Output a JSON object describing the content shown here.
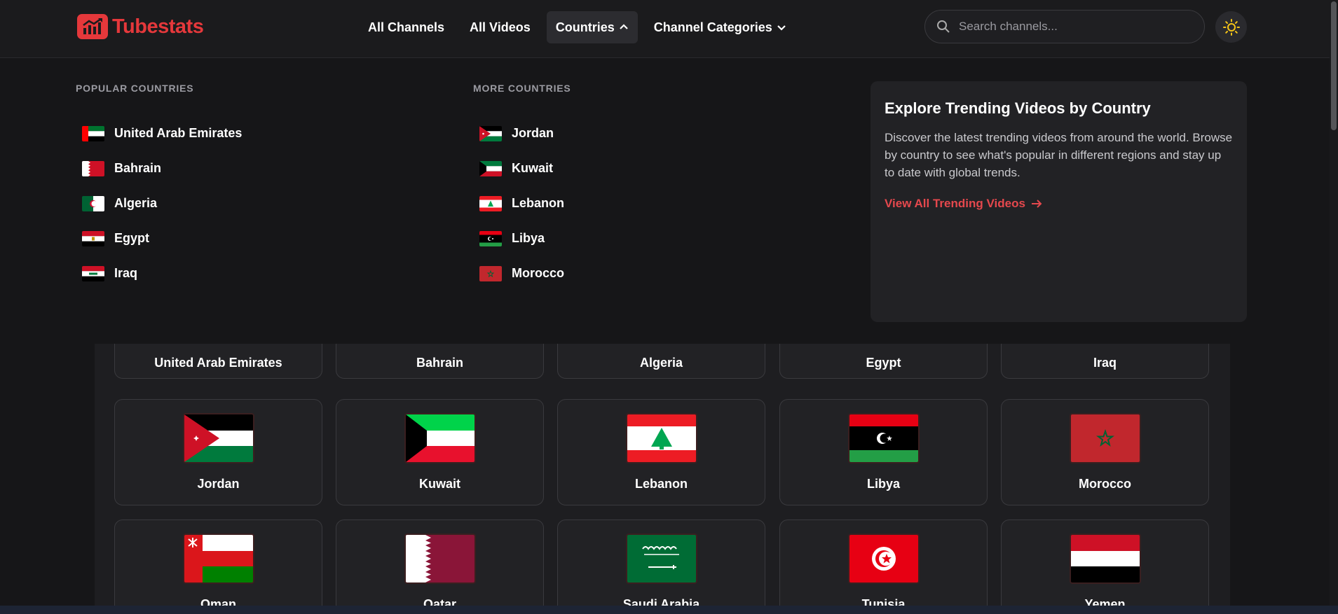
{
  "app": {
    "brand": "Tubestats",
    "brand_color": "#e5383b"
  },
  "nav": {
    "items": [
      {
        "label": "All Channels",
        "has_chevron": false,
        "active": false
      },
      {
        "label": "All Videos",
        "has_chevron": false,
        "active": false
      },
      {
        "label": "Countries",
        "has_chevron": true,
        "chevron": "up",
        "active": true
      },
      {
        "label": "Channel Categories",
        "has_chevron": true,
        "chevron": "down",
        "active": false
      }
    ]
  },
  "search": {
    "placeholder": "Search channels...",
    "value": ""
  },
  "dropdown": {
    "popular_heading": "POPULAR COUNTRIES",
    "more_heading": "MORE COUNTRIES",
    "popular": [
      {
        "label": "United Arab Emirates",
        "flag": "ae"
      },
      {
        "label": "Bahrain",
        "flag": "bh"
      },
      {
        "label": "Algeria",
        "flag": "dz"
      },
      {
        "label": "Egypt",
        "flag": "eg"
      },
      {
        "label": "Iraq",
        "flag": "iq"
      }
    ],
    "more": [
      {
        "label": "Jordan",
        "flag": "jo"
      },
      {
        "label": "Kuwait",
        "flag": "kw"
      },
      {
        "label": "Lebanon",
        "flag": "lb"
      },
      {
        "label": "Libya",
        "flag": "ly"
      },
      {
        "label": "Morocco",
        "flag": "ma"
      }
    ],
    "promo": {
      "title": "Explore Trending Videos by Country",
      "text": "Discover the latest trending videos from around the world. Browse by country to see what's popular in different regions and stay up to date with global trends.",
      "link": "View All Trending Videos"
    }
  },
  "grid": {
    "row1": [
      {
        "label": "United Arab Emirates",
        "flag": "ae"
      },
      {
        "label": "Bahrain",
        "flag": "bh"
      },
      {
        "label": "Algeria",
        "flag": "dz"
      },
      {
        "label": "Egypt",
        "flag": "eg"
      },
      {
        "label": "Iraq",
        "flag": "iq"
      }
    ],
    "row2": [
      {
        "label": "Jordan",
        "flag": "jo"
      },
      {
        "label": "Kuwait",
        "flag": "kw"
      },
      {
        "label": "Lebanon",
        "flag": "lb"
      },
      {
        "label": "Libya",
        "flag": "ly"
      },
      {
        "label": "Morocco",
        "flag": "ma"
      }
    ],
    "row3": [
      {
        "label": "Oman",
        "flag": "om"
      },
      {
        "label": "Qatar",
        "flag": "qa"
      },
      {
        "label": "Saudi Arabia",
        "flag": "sa"
      },
      {
        "label": "Tunisia",
        "flag": "tn"
      },
      {
        "label": "Yemen",
        "flag": "ye"
      }
    ]
  },
  "icons": {
    "logo": "chart-trend-icon",
    "search": "search-icon",
    "theme": "sun-icon",
    "chevron_up": "chevron-up-icon",
    "chevron_down": "chevron-down-icon",
    "arrow_right": "arrow-right-icon"
  }
}
